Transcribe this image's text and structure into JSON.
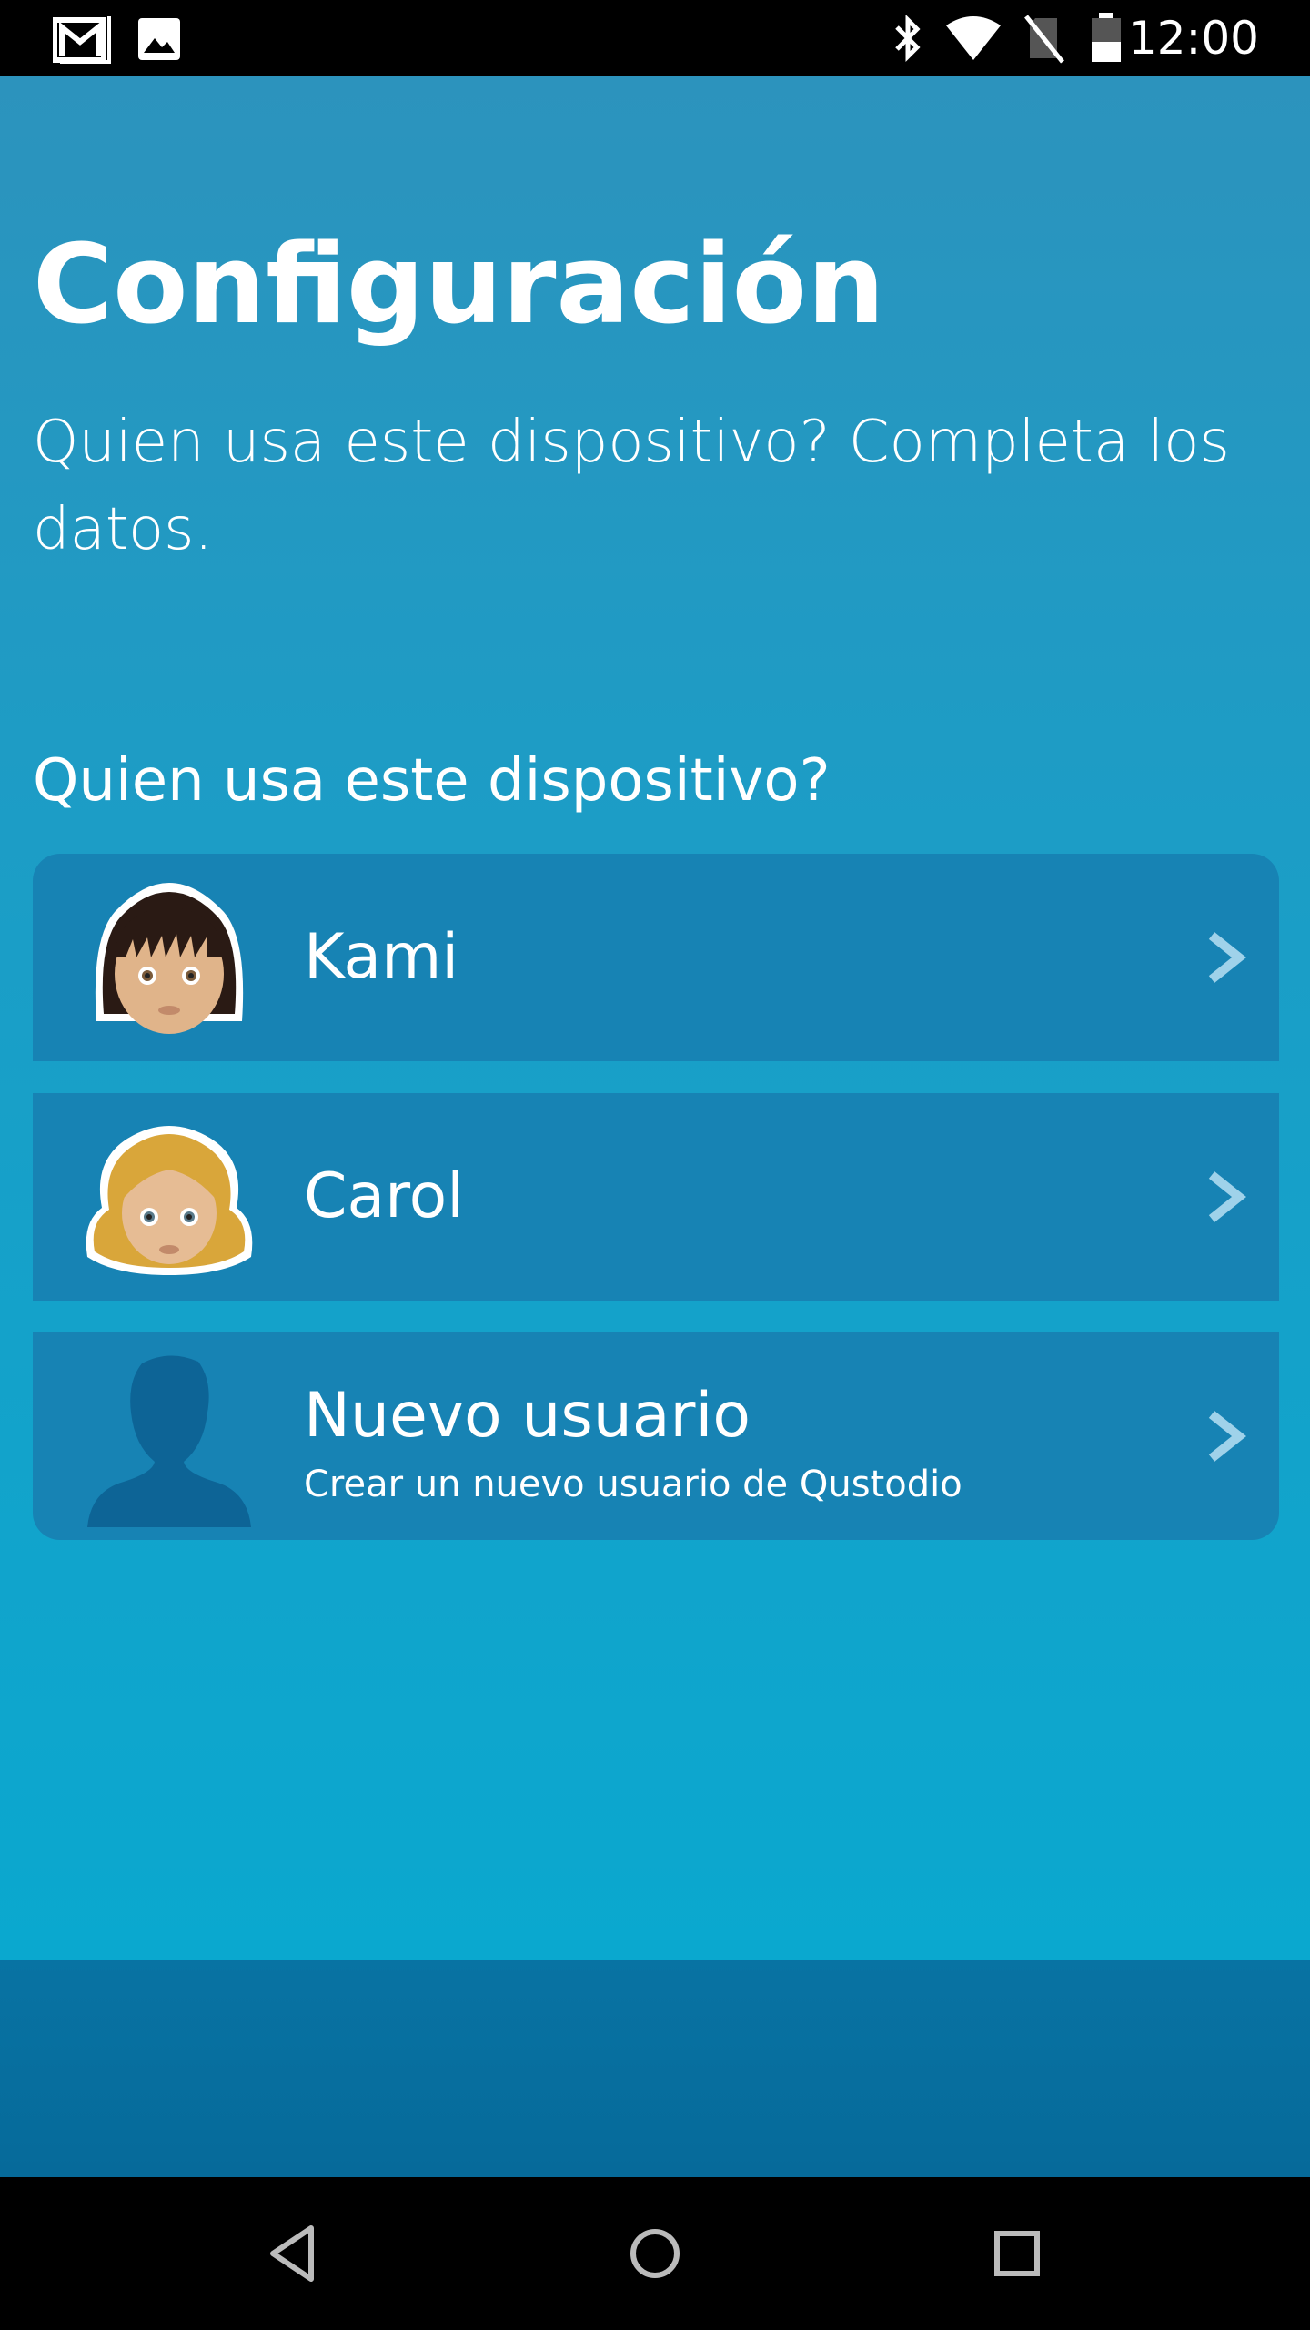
{
  "status_bar": {
    "time": "12:00",
    "icons": [
      "gmail-icon",
      "image-icon",
      "bluetooth-icon",
      "wifi-icon",
      "no-sim-icon",
      "battery-icon"
    ]
  },
  "page": {
    "title": "Configuración",
    "subtitle": "Quien usa este dispositivo? Completa los datos.",
    "section_label": "Quien usa este dispositivo?"
  },
  "users": [
    {
      "name": "Kami",
      "avatar": "girl-dark-hair-avatar"
    },
    {
      "name": "Carol",
      "avatar": "girl-blonde-hair-avatar"
    },
    {
      "name": "Nuevo usuario",
      "subtitle": "Crear un nuevo usuario de Qustodio",
      "avatar": "person-silhouette-icon"
    }
  ],
  "nav_bar": {
    "buttons": [
      "back-icon",
      "home-icon",
      "recents-icon"
    ]
  },
  "colors": {
    "card": "#1783b4",
    "footer": "#0873a3"
  }
}
